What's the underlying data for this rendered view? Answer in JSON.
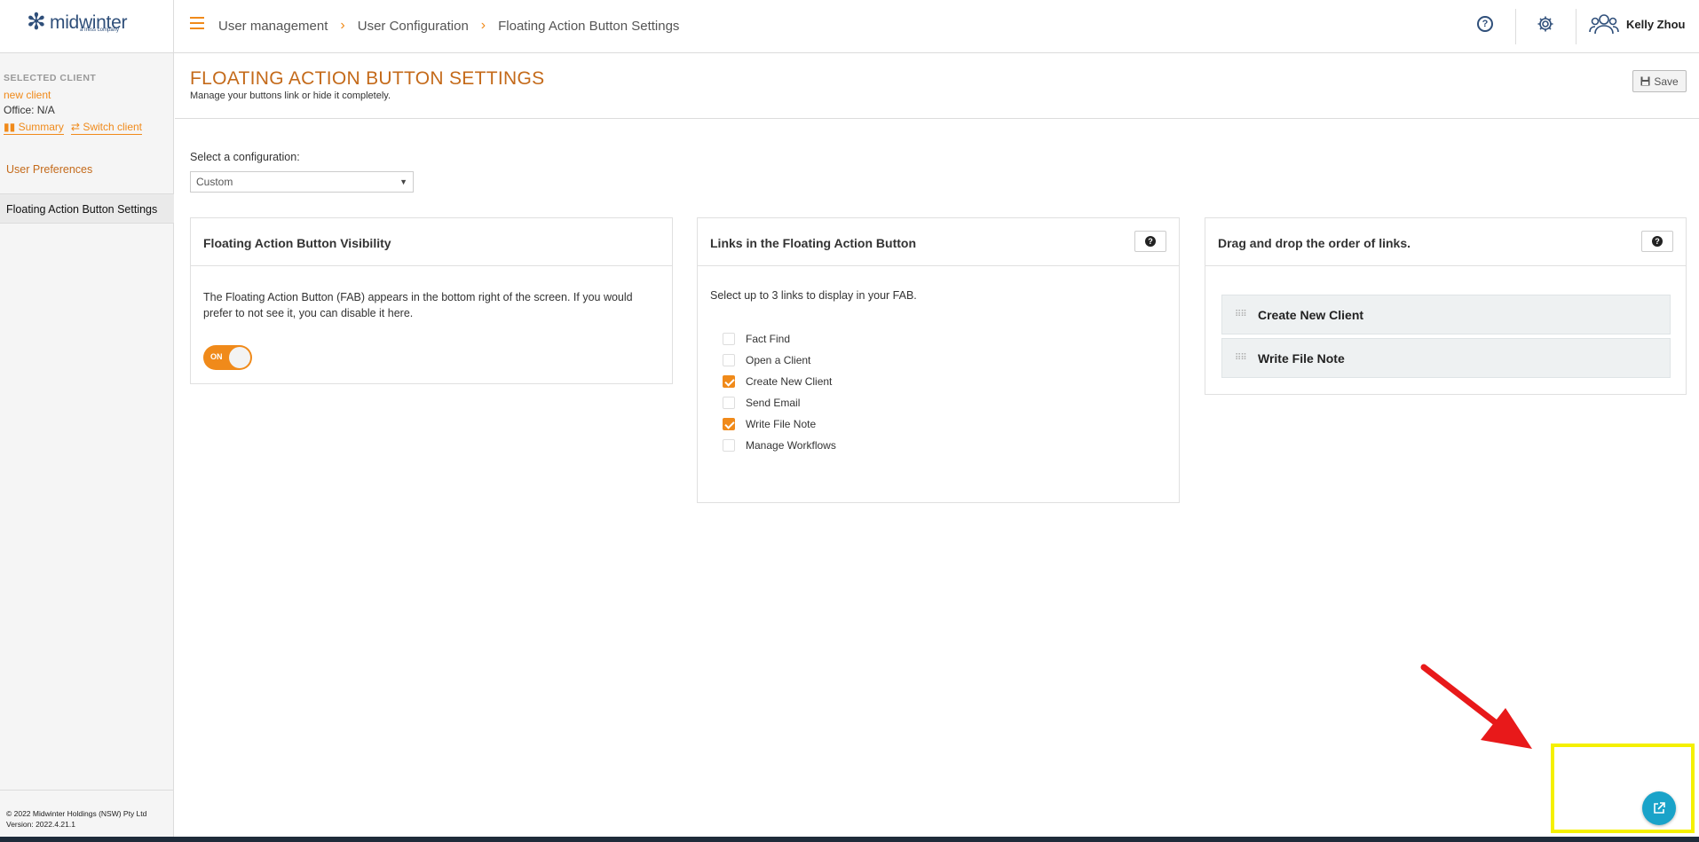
{
  "app": {
    "logo_name": "midwinter",
    "logo_tagline": "a Iress company"
  },
  "breadcrumb": [
    "User management",
    "User Configuration",
    "Floating Action Button Settings"
  ],
  "user": {
    "name": "Kelly Zhou"
  },
  "sidebar": {
    "selected_client_label": "SELECTED CLIENT",
    "client_name": "new client",
    "office": "Office: N/A",
    "summary_link": "Summary",
    "switch_link": "Switch client",
    "items": [
      {
        "label": "User Preferences",
        "active": false
      },
      {
        "label": "Floating Action Button Settings",
        "active": true
      }
    ],
    "footer": {
      "copyright": "© 2022 Midwinter Holdings (NSW) Pty Ltd",
      "version": "Version: 2022.4.21.1"
    }
  },
  "page": {
    "title": "FLOATING ACTION BUTTON SETTINGS",
    "subtitle": "Manage your buttons link or hide it completely.",
    "save_label": "Save",
    "config_label": "Select a configuration:",
    "config_value": "Custom"
  },
  "visibility_panel": {
    "title": "Floating Action Button Visibility",
    "description": "The Floating Action Button (FAB) appears in the bottom right of the screen. If you would prefer to not see it, you can disable it here.",
    "toggle_label": "ON",
    "toggle_on": true
  },
  "links_panel": {
    "title": "Links in the Floating Action Button",
    "description": "Select up to 3 links to display in your FAB.",
    "options": [
      {
        "label": "Fact Find",
        "checked": false
      },
      {
        "label": "Open a Client",
        "checked": false
      },
      {
        "label": "Create New Client",
        "checked": true
      },
      {
        "label": "Send Email",
        "checked": false
      },
      {
        "label": "Write File Note",
        "checked": true
      },
      {
        "label": "Manage Workflows",
        "checked": false
      }
    ]
  },
  "order_panel": {
    "title": "Drag and drop the order of links.",
    "items": [
      "Create New Client",
      "Write File Note"
    ]
  },
  "colors": {
    "accent": "#f08a1a",
    "fab": "#1aa3c9",
    "annotation_arrow": "#e8191a",
    "annotation_box": "#f5f000"
  }
}
